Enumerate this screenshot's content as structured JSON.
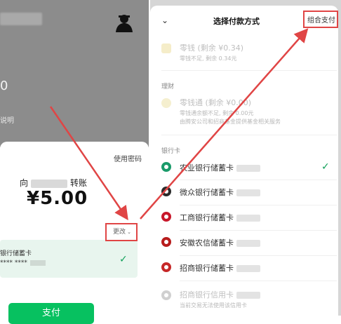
{
  "left_screen": {
    "top_value": "0",
    "top_minitext": "说明",
    "use_password": "使用密码",
    "transfer": {
      "prefix": "向",
      "suffix": "转账"
    },
    "amount": "¥5.00",
    "change": "更改",
    "card_label": "银行储蓄卡",
    "card_mask": "**** ****",
    "pay_button": "支付"
  },
  "right_screen": {
    "title": "选择付款方式",
    "combo_payment": "组合支付",
    "wallet": {
      "title": "零钱 (剩余 ¥0.34)",
      "sub": "零钱不足, 剩余 0.34元"
    },
    "section_wealth": "理财",
    "lqt": {
      "title": "零钱通 (剩余 ¥0.00)",
      "sub1": "零钱通余额不足, 剩余 0.00元",
      "sub2": "由腾安公司和招商基金提供基金相关服务"
    },
    "section_bank": "银行卡",
    "banks": [
      {
        "name": "农业银行储蓄卡",
        "color": "#1a9b6a"
      },
      {
        "name": "微众银行储蓄卡",
        "color": "#2b2b2b"
      },
      {
        "name": "工商银行储蓄卡",
        "color": "#c8172a"
      },
      {
        "name": "安徽农信储蓄卡",
        "color": "#b71c1c"
      },
      {
        "name": "招商银行储蓄卡",
        "color": "#c62828"
      },
      {
        "name": "招商银行信用卡",
        "color": "#d0d0d0"
      }
    ],
    "bank_last_sub": "当前交易无法使用该信用卡"
  },
  "colors": {
    "green": "#07c160",
    "annotation": "#e04545"
  }
}
